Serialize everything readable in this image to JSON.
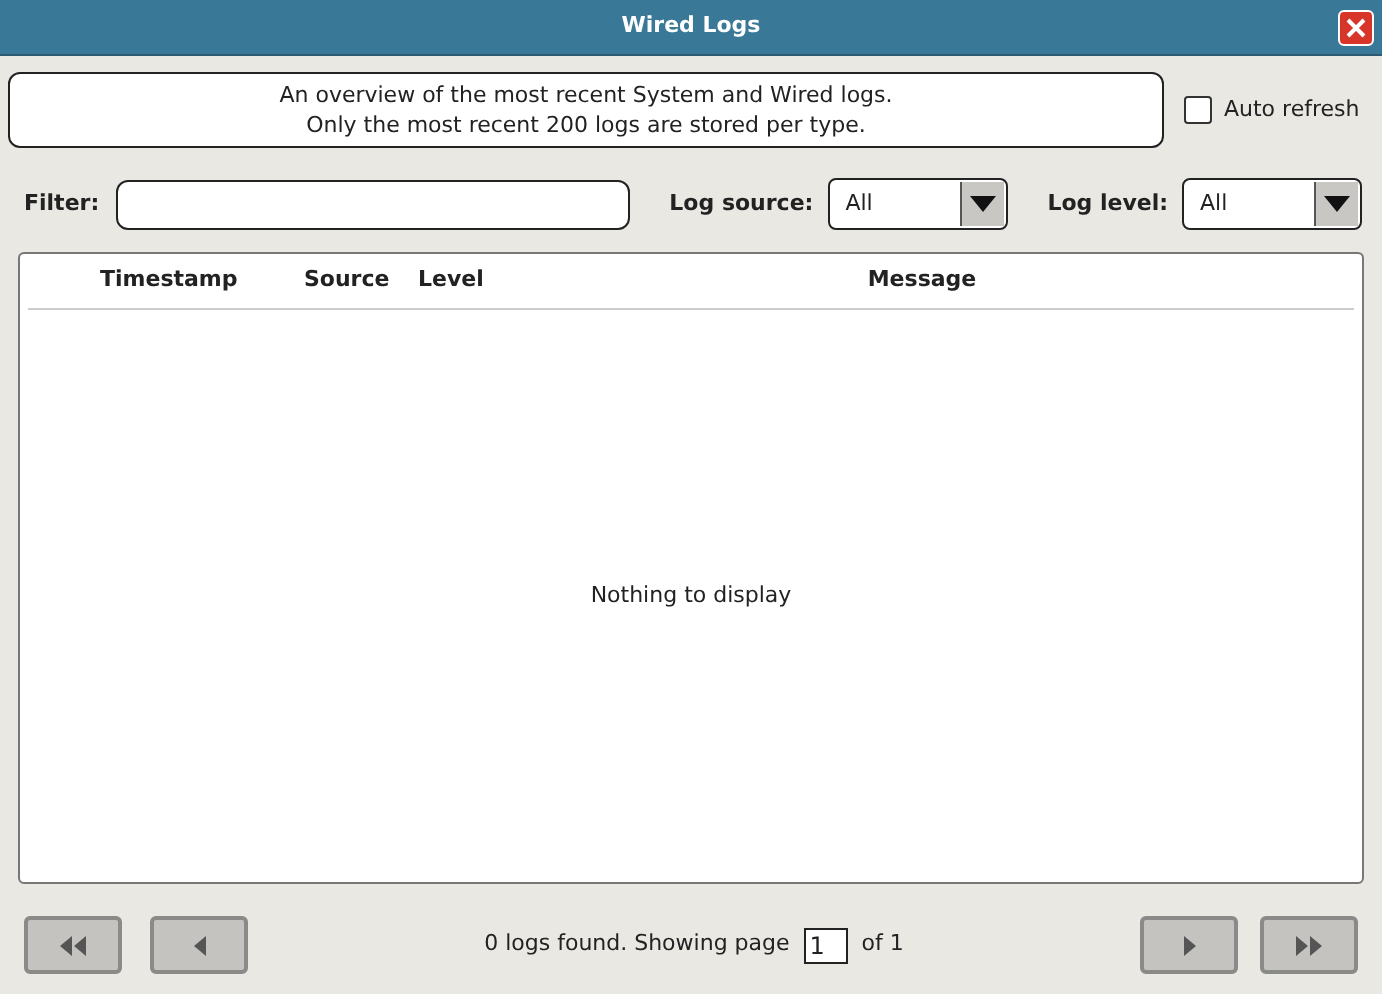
{
  "window": {
    "title": "Wired Logs"
  },
  "info": [
    "An overview of the most recent System and Wired logs.",
    "Only the most recent 200 logs are stored per type."
  ],
  "auto_refresh": {
    "label": "Auto refresh",
    "checked": false
  },
  "filter": {
    "label": "Filter:"
  },
  "log_source": {
    "label": "Log source:",
    "value": "All"
  },
  "log_level": {
    "label": "Log level:",
    "value": "All"
  },
  "table": {
    "columns": [
      "Timestamp",
      "Source",
      "Level",
      "Message"
    ],
    "empty_text": "Nothing to display"
  },
  "pager": {
    "status": "0 logs found. Showing page",
    "page": "1",
    "of": "of 1",
    "first_disabled": true,
    "prev_disabled": true,
    "next_disabled": true,
    "last_disabled": true
  }
}
